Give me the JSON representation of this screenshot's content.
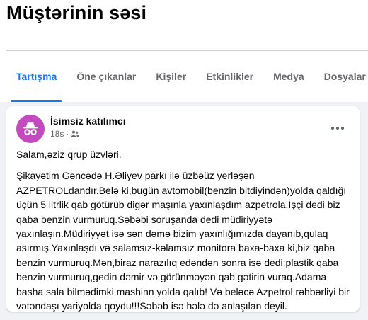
{
  "group": {
    "title": "Müştərinin səsi"
  },
  "tabs": [
    {
      "label": "Tartışma",
      "active": true
    },
    {
      "label": "Öne çıkanlar"
    },
    {
      "label": "Kişiler"
    },
    {
      "label": "Etkinlikler"
    },
    {
      "label": "Medya"
    },
    {
      "label": "Dosyalar"
    }
  ],
  "post": {
    "author": "İsimsiz katılımcı",
    "time": "18s",
    "greeting": "Salam,əziz qrup üzvləri.",
    "body": "Şikayətim Gəncədə H.Əliyev parkı ilə üzbəüz yerləşən AZPETROLdandır.Belə ki,bugün avtomobil(benzin bitdiyindən)yolda qaldığı üçün 5 litrlik qab götürüb digər maşınla yaxınlaşdım azpetrola.İşçi dedi biz qaba benzin vurmuruq.Səbəbi soruşanda dedi müdiriyyətə yaxınlaşın.Müdiriyyət isə sən dəmə bizim yaxınlığımızda dayanıb,qulaq asırmış.Yaxınlaşdı və salamsız-kəlamsız monitora baxa-baxa ki,biz qaba benzin vurmuruq.Mən,biraz narazılıq edəndən sonra isə dedi:plastik qaba benzin vurmuruq,gedin dəmir və görünməyən qab gətirin vuraq.Adama basha sala bilmədimki mashinn yolda qalıb! Və beləcə Azpetrol rəhbərliyi bir vətəndaşı yariyolda qoydu!!!Səbəb isə hələ də anlaşılan deyil."
  },
  "colors": {
    "accent": "#1877f2",
    "avatar_bg": "#c44bbf",
    "secondary_text": "#65676b"
  },
  "icons": {
    "avatar": "anonymous-incognito-icon",
    "audience": "group-audience-icon",
    "more": "more-horizontal-icon"
  }
}
